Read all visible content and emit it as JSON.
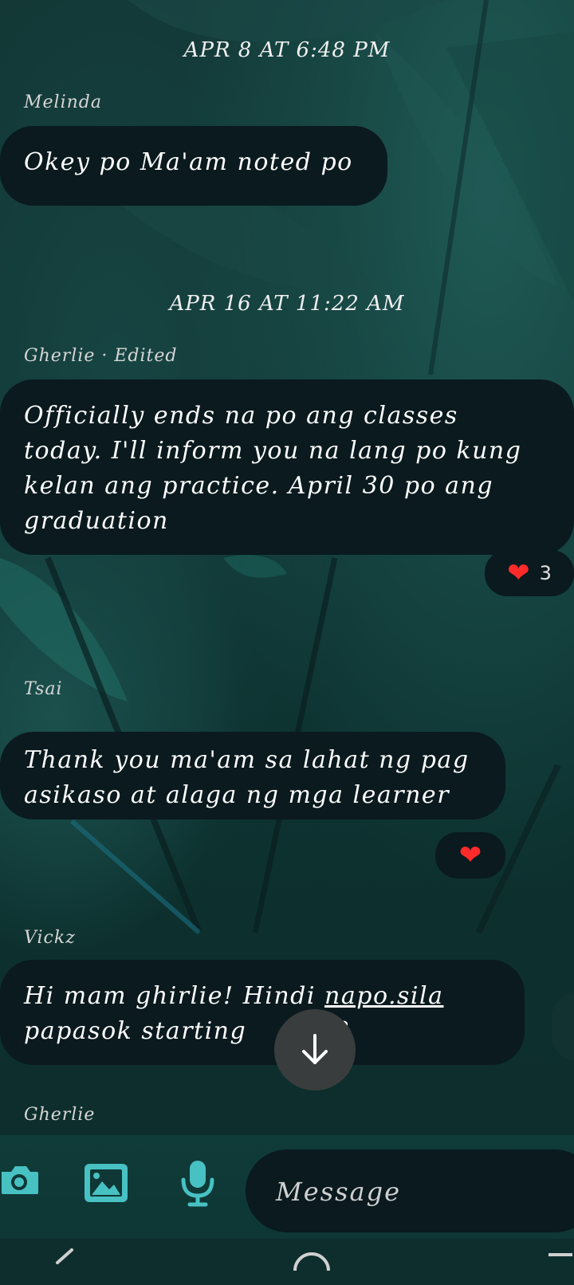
{
  "conversation": {
    "groups": [
      {
        "timestamp": "APR 8 AT 6:48 PM"
      },
      {
        "timestamp": "APR 16 AT 11:22 AM"
      }
    ],
    "messages": [
      {
        "sender": "Melinda",
        "text": "Okey po Ma'am noted po"
      },
      {
        "sender": "Gherlie",
        "edited_label": "· Edited",
        "lines": [
          "Officially ends na po ang classes",
          "today. I'll inform you na lang po kung",
          "kelan ang practice. April 30 po ang",
          "graduation"
        ],
        "reaction": {
          "icon": "heart",
          "count": "3"
        }
      },
      {
        "sender": "Tsai",
        "lines": [
          "Thank you ma'am sa lahat ng pag",
          "asikaso at alaga ng mga learner"
        ],
        "reaction": {
          "icon": "heart"
        }
      },
      {
        "sender": "Vickz",
        "line1_start": "Hi mam ghirlie! Hindi ",
        "line1_link": "napo.sila",
        "line2_start": "papasok starting ",
        "line2_end": "?"
      },
      {
        "sender": "Gherlie"
      }
    ]
  },
  "composer": {
    "placeholder": "Message",
    "icons": [
      "camera-icon",
      "gallery-icon",
      "microphone-icon"
    ]
  },
  "scroll_button": {
    "icon": "arrow-down-icon"
  },
  "colors": {
    "bubble": "#0a1a1e",
    "heart": "#ff2a2a",
    "background": "#0f3432"
  }
}
